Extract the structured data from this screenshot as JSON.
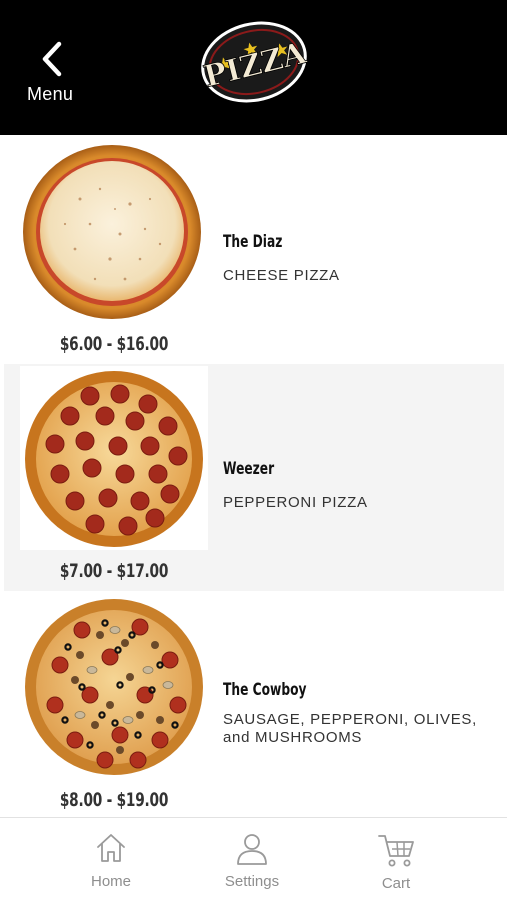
{
  "header": {
    "back_label": "Menu",
    "logo_text": "PIZZA",
    "background": "#000000"
  },
  "items": [
    {
      "name": "The Diaz",
      "description": "CHEESE PIZZA",
      "price": "$6.00 - $16.00",
      "image": "cheese-pizza"
    },
    {
      "name": "Weezer",
      "description": "PEPPERONI PIZZA",
      "price": "$7.00 - $17.00",
      "image": "pepperoni-pizza"
    },
    {
      "name": "The Cowboy",
      "description": "SAUSAGE, PEPPERONI, OLIVES, and MUSHROOMS",
      "price": "$8.00 - $19.00",
      "image": "supreme-pizza"
    }
  ],
  "tabbar": {
    "tabs": [
      {
        "label": "Home",
        "icon": "home-icon"
      },
      {
        "label": "Settings",
        "icon": "user-icon"
      },
      {
        "label": "Cart",
        "icon": "cart-icon"
      }
    ]
  },
  "colors": {
    "accent_alt_row": "#f4f4f4",
    "tab_gray": "#8e8e8e"
  }
}
